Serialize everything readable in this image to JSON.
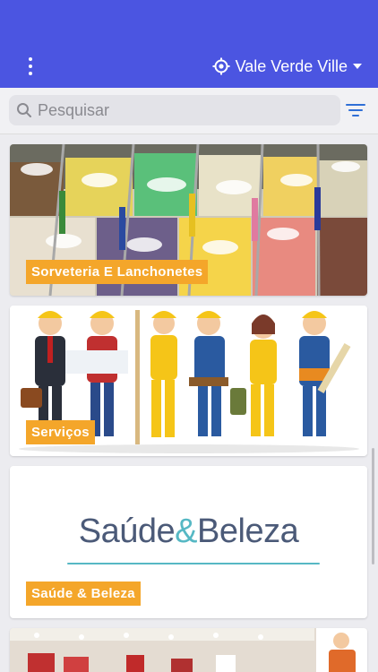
{
  "header": {
    "location": "Vale Verde Ville",
    "menu_icon": "more-vertical-icon",
    "location_icon": "location-target-icon",
    "bg_color": "#4b55e1"
  },
  "search": {
    "placeholder": "Pesquisar",
    "icon": "search-icon",
    "filter_icon": "filter-icon"
  },
  "categories": [
    {
      "label": "Sorveteria E Lanchonetes"
    },
    {
      "label": "Serviços"
    },
    {
      "label": "Saúde & Beleza",
      "brand_left": "Saúde",
      "brand_amp": "&",
      "brand_right": "Beleza"
    },
    {
      "label": ""
    }
  ],
  "accent_color": "#f4a62a"
}
